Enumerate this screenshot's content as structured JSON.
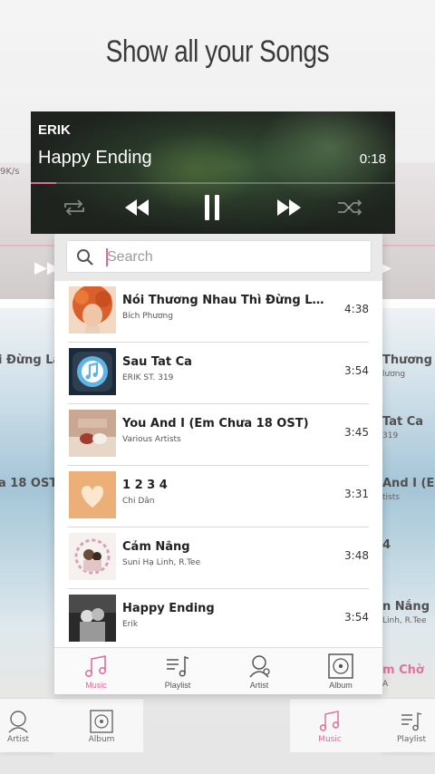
{
  "headline": "Show all your Songs",
  "player": {
    "artist": "ERIK",
    "title": "Happy Ending",
    "time": "0:18",
    "progress": 0.07,
    "accent": "#e0689a"
  },
  "search": {
    "placeholder": "Search"
  },
  "songs": [
    {
      "title": "Nói Thương Nhau Thì Đừng Làm T...",
      "artist": "Bích Phương",
      "duration": "4:38"
    },
    {
      "title": "Sau Tat Ca",
      "artist": "ERIK ST. 319",
      "duration": "3:54"
    },
    {
      "title": "You And I  (Em Chưa 18 OST)",
      "artist": "Various Artists",
      "duration": "3:45"
    },
    {
      "title": "1 2 3 4",
      "artist": "Chi Dân",
      "duration": "3:31"
    },
    {
      "title": "Cảm Nắng",
      "artist": "Suni Hạ Linh, R.Tee",
      "duration": "3:48"
    },
    {
      "title": "Happy Ending",
      "artist": "Erik",
      "duration": "3:54"
    }
  ],
  "tabs": [
    {
      "label": "Music",
      "icon": "music-note-icon",
      "active": true
    },
    {
      "label": "Playlist",
      "icon": "playlist-icon",
      "active": false
    },
    {
      "label": "Artist",
      "icon": "artist-icon",
      "active": false
    },
    {
      "label": "Album",
      "icon": "album-icon",
      "active": false
    }
  ],
  "background": {
    "speed": "9K/s",
    "left_rows": [
      "i Đừng Lả",
      "a 18 OST"
    ],
    "right_rows": [
      {
        "title": "Thương N",
        "sub": "lương"
      },
      {
        "title": "Tat Ca",
        "sub": "319"
      },
      {
        "title": "And I  (E",
        "sub": "tists"
      },
      {
        "title": "4",
        "sub": ""
      },
      {
        "title": "n Nắng",
        "sub": "Linh, R.Tee"
      },
      {
        "title": "m Chờ",
        "sub": "A"
      }
    ],
    "bottom_left_tabs": [
      "Artist",
      "Album"
    ],
    "bottom_right_tabs": [
      "Music",
      "Playlist"
    ]
  }
}
